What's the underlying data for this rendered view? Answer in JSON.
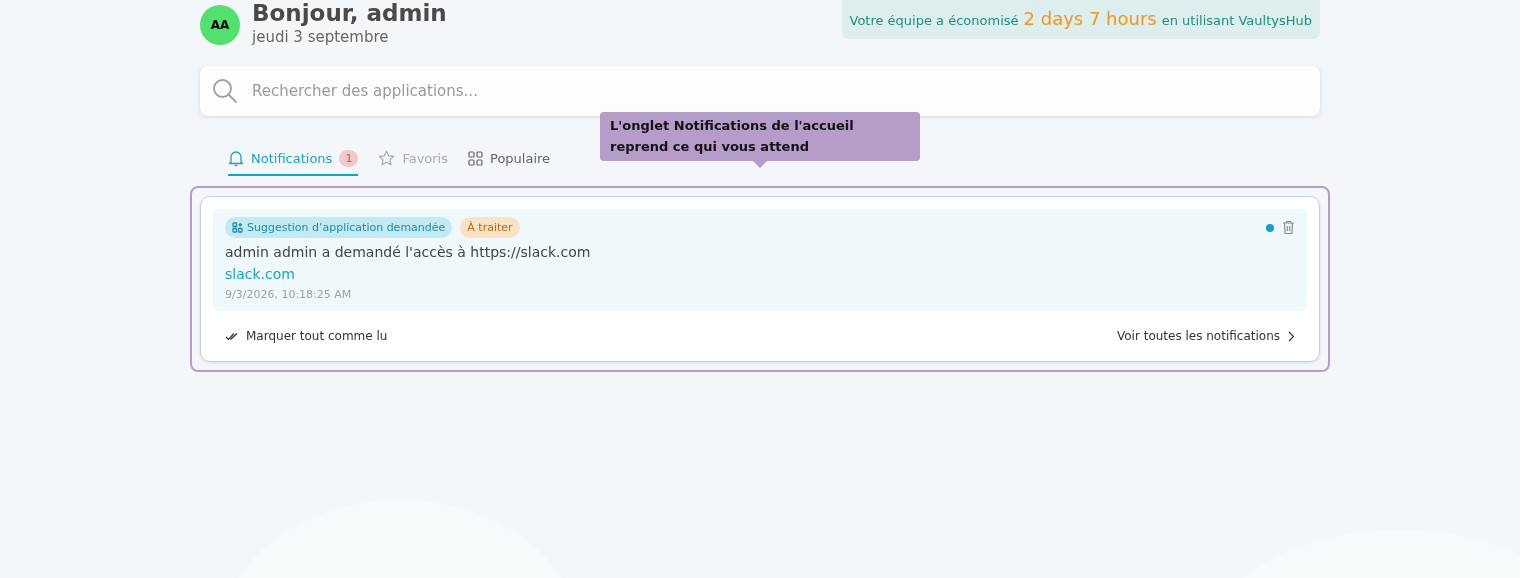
{
  "header": {
    "avatar": "AA",
    "greeting": "Bonjour, admin",
    "date": "jeudi 3 septembre"
  },
  "savings": {
    "before": "Votre équipe a économisé",
    "amount": "2 days 7 hours",
    "after": "en utilisant VaultysHub"
  },
  "search": {
    "placeholder": "Rechercher des applications..."
  },
  "tabs": [
    {
      "label": "Notifications",
      "kind": "bell",
      "count": "1",
      "selected": true,
      "disabled": false
    },
    {
      "label": "Favoris",
      "kind": "star",
      "selected": false,
      "disabled": true
    },
    {
      "label": "Populaire",
      "kind": "grid",
      "selected": false,
      "disabled": false
    }
  ],
  "tooltip": {
    "text": "L'onglet Notifications de l'accueil reprend ce qui vous attend"
  },
  "notifications": [
    {
      "category": "Suggestion d’application demandée",
      "status": "À traiter",
      "message": "admin admin a demandé l'accès à https://slack.com",
      "link": "slack.com",
      "time": "9/3/2026, 10:18:25 AM",
      "unread": true
    }
  ],
  "footer": {
    "mark_all": "Marquer tout comme lu",
    "view_all": "Voir toutes les notifications"
  }
}
